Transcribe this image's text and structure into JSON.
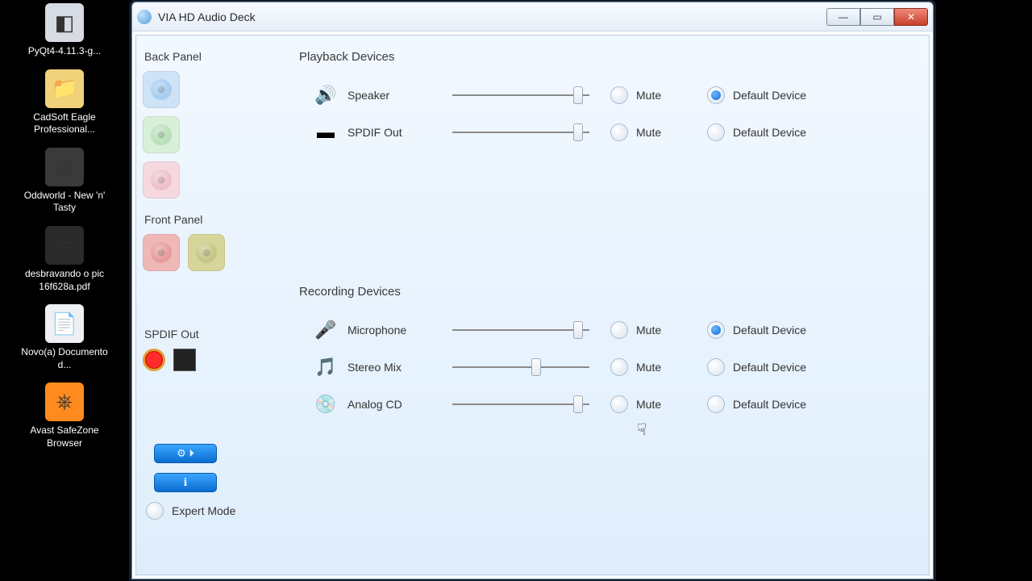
{
  "desktop": {
    "items": [
      {
        "label": "PyQt4-4.11.3-g...",
        "icon_bg": "#d6dbe4",
        "glyph": "◧"
      },
      {
        "label": "CadSoft Eagle Professional...",
        "icon_bg": "#f0d27a",
        "glyph": "📁"
      },
      {
        "label": "Oddworld - New 'n' Tasty",
        "icon_bg": "#3a3a3a",
        "glyph": "◎"
      },
      {
        "label": "desbravando o pic 16f628a.pdf",
        "icon_bg": "#2a2a2a",
        "glyph": "PIC"
      },
      {
        "label": "Novo(a) Documento d...",
        "icon_bg": "#eef0f3",
        "glyph": "📄"
      },
      {
        "label": "Avast SafeZone Browser",
        "icon_bg": "#ff8a1f",
        "glyph": "⎈"
      }
    ]
  },
  "window": {
    "title": "VIA HD Audio Deck",
    "btn_min": "—",
    "btn_max": "▭",
    "btn_close": "✕"
  },
  "left": {
    "back_panel_label": "Back Panel",
    "front_panel_label": "Front Panel",
    "spdif_label": "SPDIF Out",
    "expert_label": "Expert Mode",
    "tool1_glyph": "⚙ ⏵",
    "tool2_glyph": "ℹ"
  },
  "playback": {
    "title": "Playback Devices",
    "rows": [
      {
        "name": "Speaker",
        "icon": "🔊",
        "volume": 95,
        "mute": false,
        "default": true,
        "mute_label": "Mute",
        "default_label": "Default Device"
      },
      {
        "name": "SPDIF Out",
        "icon": "▬",
        "volume": 95,
        "mute": false,
        "default": false,
        "mute_label": "Mute",
        "default_label": "Default Device"
      }
    ]
  },
  "recording": {
    "title": "Recording Devices",
    "rows": [
      {
        "name": "Microphone",
        "icon": "🎤",
        "volume": 95,
        "mute": false,
        "default": true,
        "mute_label": "Mute",
        "default_label": "Default Device"
      },
      {
        "name": "Stereo Mix",
        "icon": "🎵",
        "volume": 62,
        "mute": false,
        "default": false,
        "mute_label": "Mute",
        "default_label": "Default Device"
      },
      {
        "name": "Analog CD",
        "icon": "💿",
        "volume": 95,
        "mute": false,
        "default": false,
        "mute_label": "Mute",
        "default_label": "Default Device"
      }
    ]
  }
}
